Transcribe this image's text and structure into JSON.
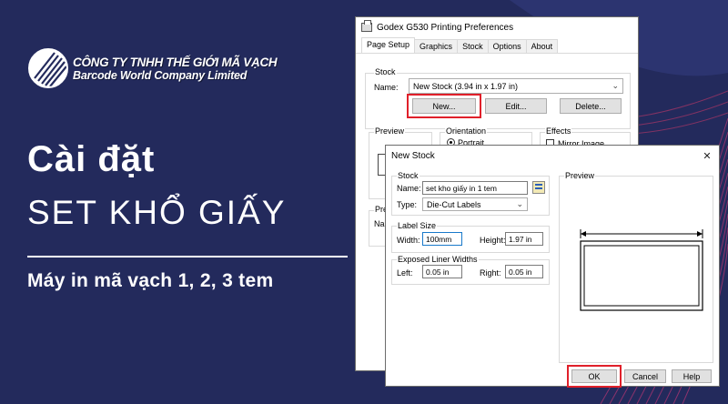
{
  "brand": {
    "company_vn": "CÔNG TY TNHH THẾ GIỚI MÃ VẠCH",
    "company_en": "Barcode World Company Limited"
  },
  "headline": {
    "line1": "Cài đặt",
    "line2": "SET KHỔ GIẤY",
    "subtitle": "Máy in mã vạch 1, 2, 3 tem"
  },
  "prefs_dialog": {
    "title": "Godex G530 Printing Preferences",
    "tabs": [
      "Page Setup",
      "Graphics",
      "Stock",
      "Options",
      "About"
    ],
    "stock_group": "Stock",
    "name_label": "Name:",
    "name_value": "New Stock (3.94 in x 1.97 in)",
    "new_button": "New...",
    "edit_button": "Edit...",
    "delete_button": "Delete...",
    "preview_group": "Preview",
    "orientation_group": "Orientation",
    "portrait_label": "Portrait",
    "effects_group": "Effects",
    "mirror_label": "Mirror Image",
    "partial_group": "Pre",
    "partial_label": "Na"
  },
  "new_stock_dialog": {
    "title": "New Stock",
    "close": "✕",
    "stock_group": "Stock",
    "name_label": "Name:",
    "name_value": "set kho giấy in 1 tem",
    "type_label": "Type:",
    "type_value": "Die-Cut Labels",
    "label_size_group": "Label Size",
    "width_label": "Width:",
    "width_value": "100mm",
    "height_label": "Height:",
    "height_value": "1.97 in",
    "liner_group": "Exposed Liner Widths",
    "left_label": "Left:",
    "left_value": "0.05 in",
    "right_label": "Right:",
    "right_value": "0.05 in",
    "preview_group": "Preview",
    "ok_button": "OK",
    "cancel_button": "Cancel",
    "help_button": "Help"
  },
  "colors": {
    "background": "#232a5c",
    "highlight_box": "#e0202a",
    "accent_pink": "#d2336b"
  }
}
